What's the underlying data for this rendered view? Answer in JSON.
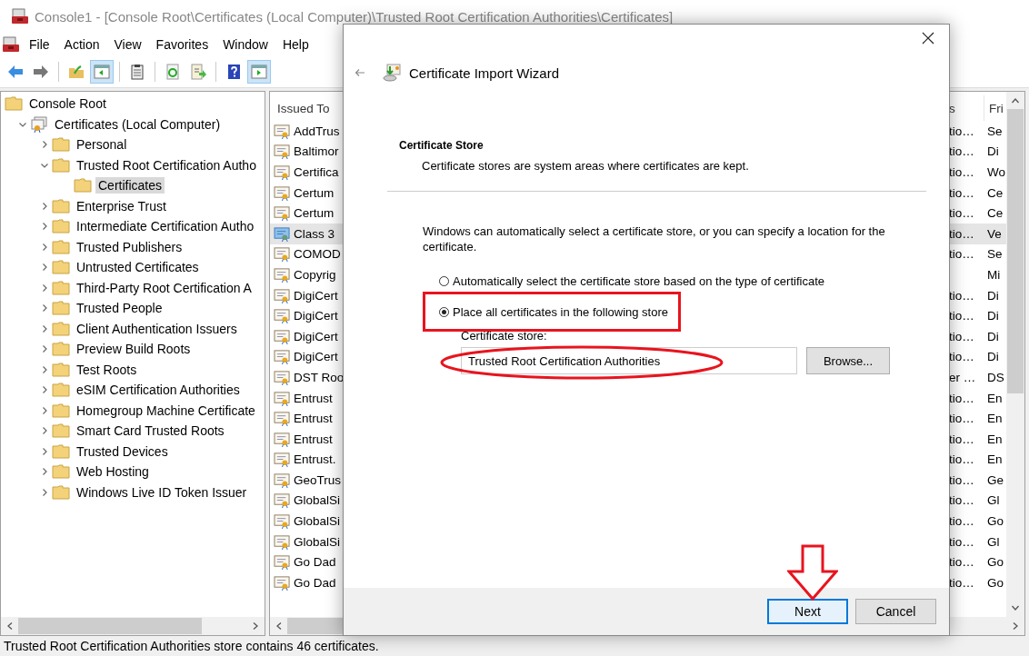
{
  "window": {
    "title": "Console1 - [Console Root\\Certificates (Local Computer)\\Trusted Root Certification Authorities\\Certificates]"
  },
  "menu": [
    "File",
    "Action",
    "View",
    "Favorites",
    "Window",
    "Help"
  ],
  "toolbar": [
    {
      "pressed": false
    },
    {
      "pressed": false
    },
    {
      "pressed": false
    },
    {
      "pressed": true
    },
    {
      "pressed": false
    },
    {
      "pressed": false
    },
    {
      "pressed": false
    },
    {
      "pressed": false
    },
    {
      "pressed": true
    }
  ],
  "tree": [
    {
      "label": "Console Root",
      "selected": false,
      "children": [
        {
          "label": "Certificates (Local Computer)",
          "selected": false,
          "expanded": true,
          "children": [
            {
              "label": "Personal",
              "selected": false,
              "expanded": false
            },
            {
              "label": "Trusted Root Certification Autho",
              "selected": false,
              "expanded": true,
              "children": [
                {
                  "label": "Certificates",
                  "selected": true
                }
              ]
            },
            {
              "label": "Enterprise Trust",
              "selected": false,
              "expanded": false
            },
            {
              "label": "Intermediate Certification Autho",
              "selected": false,
              "expanded": false
            },
            {
              "label": "Trusted Publishers",
              "selected": false,
              "expanded": false
            },
            {
              "label": "Untrusted Certificates",
              "selected": false,
              "expanded": false
            },
            {
              "label": "Third-Party Root Certification A",
              "selected": false,
              "expanded": false
            },
            {
              "label": "Trusted People",
              "selected": false,
              "expanded": false
            },
            {
              "label": "Client Authentication Issuers",
              "selected": false,
              "expanded": false
            },
            {
              "label": "Preview Build Roots",
              "selected": false,
              "expanded": false
            },
            {
              "label": "Test Roots",
              "selected": false,
              "expanded": false
            },
            {
              "label": "eSIM Certification Authorities",
              "selected": false,
              "expanded": false
            },
            {
              "label": "Homegroup Machine Certificate",
              "selected": false,
              "expanded": false
            },
            {
              "label": "Smart Card Trusted Roots",
              "selected": false,
              "expanded": false
            },
            {
              "label": "Trusted Devices",
              "selected": false,
              "expanded": false
            },
            {
              "label": "Web Hosting",
              "selected": false,
              "expanded": false
            },
            {
              "label": "Windows Live ID Token Issuer",
              "selected": false,
              "expanded": false
            }
          ]
        }
      ]
    }
  ],
  "list": {
    "columns": [
      "Issued To",
      "s",
      "Fri"
    ],
    "rows": [
      {
        "issued_to": "AddTrus",
        "column_3": "tio…",
        "column_4": "Se",
        "selected": false
      },
      {
        "issued_to": "Baltimor",
        "column_3": "tio…",
        "column_4": "Di",
        "selected": false
      },
      {
        "issued_to": "Certifica",
        "column_3": "tio…",
        "column_4": "Wo",
        "selected": false
      },
      {
        "issued_to": "Certum",
        "column_3": "tio…",
        "column_4": "Ce",
        "selected": false
      },
      {
        "issued_to": "Certum",
        "column_3": "tio…",
        "column_4": "Ce",
        "selected": false
      },
      {
        "issued_to": "Class 3",
        "column_3": "tio…",
        "column_4": "Ve",
        "selected": true
      },
      {
        "issued_to": "COMOD",
        "column_3": "tio…",
        "column_4": "Se",
        "selected": false
      },
      {
        "issued_to": "Copyrig",
        "column_4": "Mi",
        "selected": false
      },
      {
        "issued_to": "DigiCert",
        "column_3": "tio…",
        "column_4": "Di",
        "selected": false
      },
      {
        "issued_to": "DigiCert",
        "column_3": "tio…",
        "column_4": "Di",
        "selected": false
      },
      {
        "issued_to": "DigiCert",
        "column_3": "tio…",
        "column_4": "Di",
        "selected": false
      },
      {
        "issued_to": "DigiCert",
        "column_3": "tio…",
        "column_4": "Di",
        "selected": false
      },
      {
        "issued_to": "DST Roo",
        "column_3": "er …",
        "column_4": "DS",
        "selected": false
      },
      {
        "issued_to": "Entrust",
        "column_3": "tio…",
        "column_4": "En",
        "selected": false
      },
      {
        "issued_to": "Entrust",
        "column_3": "tio…",
        "column_4": "En",
        "selected": false
      },
      {
        "issued_to": "Entrust",
        "column_3": "tio…",
        "column_4": "En",
        "selected": false
      },
      {
        "issued_to": "Entrust.",
        "column_3": "tio…",
        "column_4": "En",
        "selected": false
      },
      {
        "issued_to": "GeoTrus",
        "column_3": "tio…",
        "column_4": "Ge",
        "selected": false
      },
      {
        "issued_to": "GlobalSi",
        "column_3": "tio…",
        "column_4": "Gl",
        "selected": false
      },
      {
        "issued_to": "GlobalSi",
        "column_3": "tio…",
        "column_4": "Go",
        "selected": false
      },
      {
        "issued_to": "GlobalSi",
        "column_3": "tio…",
        "column_4": "Gl",
        "selected": false
      },
      {
        "issued_to": "Go Dad",
        "column_3": "tio…",
        "column_4": "Go",
        "selected": false
      },
      {
        "issued_to": "Go Dad",
        "column_3": "tio…",
        "column_4": "Go",
        "selected": false
      }
    ]
  },
  "status_bar": "Trusted Root Certification Authorities store contains 46 certificates.",
  "dialog": {
    "title": "Certificate Import Wizard",
    "section_title": "Certificate Store",
    "section_description": "Certificate stores are system areas where certificates are kept.",
    "instructions": "Windows can automatically select a certificate store, or you can specify a location for the certificate.",
    "options": [
      {
        "label": "Automatically select the certificate store based on the type of certificate",
        "selected": false
      },
      {
        "label": "Place all certificates in the following store",
        "selected": true
      }
    ],
    "store_label": "Certificate store:",
    "store_value": "Trusted Root Certification Authorities",
    "browse_button": "Browse...",
    "buttons": [
      {
        "label": "Next",
        "default": true
      },
      {
        "label": "Cancel",
        "default": false
      }
    ]
  }
}
